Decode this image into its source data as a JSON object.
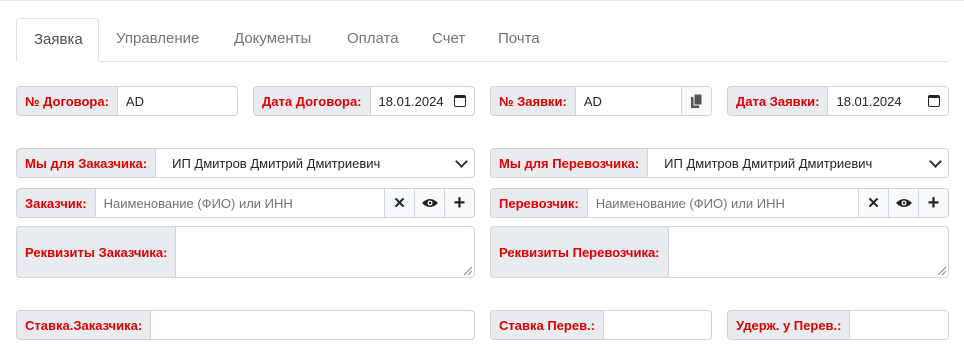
{
  "tabs": [
    "Заявка",
    "Управление",
    "Документы",
    "Оплата",
    "Счет",
    "Почта"
  ],
  "contract_no": {
    "label": "№ Договора:",
    "value": "AD"
  },
  "contract_date": {
    "label": "Дата Договора:",
    "value": "18.01.2024"
  },
  "request_no": {
    "label": "№ Заявки:",
    "value": "AD"
  },
  "request_date": {
    "label": "Дата Заявки:",
    "value": "18.01.2024"
  },
  "we_for_customer": {
    "label": "Мы для Заказчика:",
    "value": "ИП Дмитров Дмитрий Дмитриевич"
  },
  "we_for_carrier": {
    "label": "Мы для Перевозчика:",
    "value": "ИП Дмитров Дмитрий Дмитриевич"
  },
  "customer": {
    "label": "Заказчик:",
    "placeholder": "Наименование (ФИО) или ИНН"
  },
  "carrier": {
    "label": "Перевозчик:",
    "placeholder": "Наименование (ФИО) или ИНН"
  },
  "customer_details": {
    "label": "Реквизиты Заказчика:"
  },
  "carrier_details": {
    "label": "Реквизиты Перевозчика:"
  },
  "customer_rate": {
    "label": "Ставка.Заказчика:"
  },
  "carrier_rate": {
    "label": "Ставка Перев.:"
  },
  "carrier_withhold": {
    "label": "Удерж. у Перев.:"
  }
}
